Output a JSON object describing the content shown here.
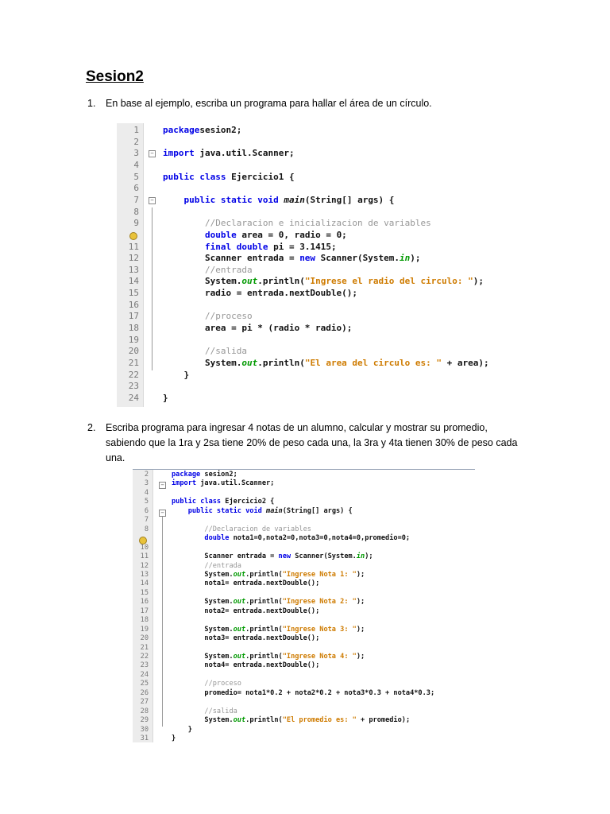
{
  "title": "Sesion2",
  "questions": [
    {
      "number": "1.",
      "text": "En base al ejemplo, escriba un programa para hallar el área de un círculo."
    },
    {
      "number": "2.",
      "text": "Escriba programa para ingresar 4 notas de un alumno, calcular y mostrar su promedio, sabiendo que la 1ra y 2sa tiene 20% de peso cada una, la 3ra y 4ta tienen 30% de peso cada una."
    }
  ],
  "code_blocks": [
    {
      "lines": [
        {
          "n": "1",
          "c": [
            [
              "kw",
              "package"
            ],
            [
              "",
              "sesion2;"
            ]
          ]
        },
        {
          "n": "2",
          "c": []
        },
        {
          "n": "3",
          "c": [
            [
              "kw",
              "import"
            ],
            [
              "",
              " java.util.Scanner;"
            ]
          ]
        },
        {
          "n": "4",
          "c": []
        },
        {
          "n": "5",
          "c": [
            [
              "kw",
              "public class"
            ],
            [
              "",
              " Ejercicio1 {"
            ]
          ]
        },
        {
          "n": "6",
          "c": []
        },
        {
          "n": "7",
          "c": [
            [
              "",
              "    "
            ],
            [
              "kw",
              "public static void"
            ],
            [
              "",
              " "
            ],
            [
              "it",
              "main"
            ],
            [
              "",
              "(String[] args) {"
            ]
          ]
        },
        {
          "n": "8",
          "c": []
        },
        {
          "n": "9",
          "c": [
            [
              "",
              "        "
            ],
            [
              "cm",
              "//Declaracion e inicializacion de variables"
            ]
          ]
        },
        {
          "n": "",
          "c": [
            [
              "",
              "        "
            ],
            [
              "kw",
              "double"
            ],
            [
              "",
              " area = 0, radio = 0;"
            ]
          ]
        },
        {
          "n": "11",
          "c": [
            [
              "",
              "        "
            ],
            [
              "kw",
              "final double"
            ],
            [
              "",
              " pi = 3.1415;"
            ]
          ]
        },
        {
          "n": "12",
          "c": [
            [
              "",
              "        Scanner entrada = "
            ],
            [
              "kw",
              "new"
            ],
            [
              "",
              " Scanner(System."
            ],
            [
              "st",
              "in"
            ],
            [
              "",
              ");"
            ]
          ]
        },
        {
          "n": "13",
          "c": [
            [
              "",
              "        "
            ],
            [
              "cm",
              "//entrada"
            ]
          ]
        },
        {
          "n": "14",
          "c": [
            [
              "",
              "        System."
            ],
            [
              "st",
              "out"
            ],
            [
              "",
              ".println("
            ],
            [
              "str",
              "\"Ingrese el radio del circulo: \""
            ],
            [
              "",
              ");"
            ]
          ]
        },
        {
          "n": "15",
          "c": [
            [
              "",
              "        radio = entrada.nextDouble();"
            ]
          ]
        },
        {
          "n": "16",
          "c": []
        },
        {
          "n": "17",
          "c": [
            [
              "",
              "        "
            ],
            [
              "cm",
              "//proceso"
            ]
          ]
        },
        {
          "n": "18",
          "c": [
            [
              "",
              "        area = pi * (radio * radio);"
            ]
          ]
        },
        {
          "n": "19",
          "c": []
        },
        {
          "n": "20",
          "c": [
            [
              "",
              "        "
            ],
            [
              "cm",
              "//salida"
            ]
          ]
        },
        {
          "n": "21",
          "c": [
            [
              "",
              "        System."
            ],
            [
              "st",
              "out"
            ],
            [
              "",
              ".println("
            ],
            [
              "str",
              "\"El area del circulo es: \""
            ],
            [
              "",
              " + area);"
            ]
          ]
        },
        {
          "n": "22",
          "c": [
            [
              "",
              "    }"
            ]
          ]
        },
        {
          "n": "23",
          "c": []
        },
        {
          "n": "24",
          "c": [
            [
              "",
              "}"
            ]
          ]
        }
      ]
    },
    {
      "lines": [
        {
          "n": "2",
          "c": [
            [
              "kw",
              "package"
            ],
            [
              "",
              " sesion2;"
            ]
          ]
        },
        {
          "n": "3",
          "c": [
            [
              "kw",
              "import"
            ],
            [
              "",
              " java.util.Scanner;"
            ]
          ]
        },
        {
          "n": "4",
          "c": []
        },
        {
          "n": "5",
          "c": [
            [
              "kw",
              "public class"
            ],
            [
              "",
              " Ejercicio2 {"
            ]
          ]
        },
        {
          "n": "6",
          "c": [
            [
              "",
              "    "
            ],
            [
              "kw",
              "public static void"
            ],
            [
              "",
              " "
            ],
            [
              "it",
              "main"
            ],
            [
              "",
              "(String[] args) {"
            ]
          ]
        },
        {
          "n": "7",
          "c": []
        },
        {
          "n": "8",
          "c": [
            [
              "",
              "        "
            ],
            [
              "cm",
              "//Declaracion de variables"
            ]
          ]
        },
        {
          "n": "",
          "c": [
            [
              "",
              "        "
            ],
            [
              "kw",
              "double"
            ],
            [
              "",
              " nota1=0,nota2=0,nota3=0,nota4=0,promedio=0;"
            ]
          ]
        },
        {
          "n": "10",
          "c": []
        },
        {
          "n": "11",
          "c": [
            [
              "",
              "        Scanner entrada = "
            ],
            [
              "kw",
              "new"
            ],
            [
              "",
              " Scanner(System."
            ],
            [
              "st",
              "in"
            ],
            [
              "",
              ");"
            ]
          ]
        },
        {
          "n": "12",
          "c": [
            [
              "",
              "        "
            ],
            [
              "cm",
              "//entrada"
            ]
          ]
        },
        {
          "n": "13",
          "c": [
            [
              "",
              "        System."
            ],
            [
              "st",
              "out"
            ],
            [
              "",
              ".println("
            ],
            [
              "str",
              "\"Ingrese Nota 1: \""
            ],
            [
              "",
              ");"
            ]
          ]
        },
        {
          "n": "14",
          "c": [
            [
              "",
              "        nota1= entrada.nextDouble();"
            ]
          ]
        },
        {
          "n": "15",
          "c": []
        },
        {
          "n": "16",
          "c": [
            [
              "",
              "        System."
            ],
            [
              "st",
              "out"
            ],
            [
              "",
              ".println("
            ],
            [
              "str",
              "\"Ingrese Nota 2: \""
            ],
            [
              "",
              ");"
            ]
          ]
        },
        {
          "n": "17",
          "c": [
            [
              "",
              "        nota2= entrada.nextDouble();"
            ]
          ]
        },
        {
          "n": "18",
          "c": []
        },
        {
          "n": "19",
          "c": [
            [
              "",
              "        System."
            ],
            [
              "st",
              "out"
            ],
            [
              "",
              ".println("
            ],
            [
              "str",
              "\"Ingrese Nota 3: \""
            ],
            [
              "",
              ");"
            ]
          ]
        },
        {
          "n": "20",
          "c": [
            [
              "",
              "        nota3= entrada.nextDouble();"
            ]
          ]
        },
        {
          "n": "21",
          "c": []
        },
        {
          "n": "22",
          "c": [
            [
              "",
              "        System."
            ],
            [
              "st",
              "out"
            ],
            [
              "",
              ".println("
            ],
            [
              "str",
              "\"Ingrese Nota 4: \""
            ],
            [
              "",
              ");"
            ]
          ]
        },
        {
          "n": "23",
          "c": [
            [
              "",
              "        nota4= entrada.nextDouble();"
            ]
          ]
        },
        {
          "n": "24",
          "c": []
        },
        {
          "n": "25",
          "c": [
            [
              "",
              "        "
            ],
            [
              "cm",
              "//proceso"
            ]
          ]
        },
        {
          "n": "26",
          "c": [
            [
              "",
              "        promedio= nota1*0.2 + nota2*0.2 + nota3*0.3 + nota4*0.3;"
            ]
          ]
        },
        {
          "n": "27",
          "c": []
        },
        {
          "n": "28",
          "c": [
            [
              "",
              "        "
            ],
            [
              "cm",
              "//salida"
            ]
          ]
        },
        {
          "n": "29",
          "c": [
            [
              "",
              "        System."
            ],
            [
              "st",
              "out"
            ],
            [
              "",
              ".println("
            ],
            [
              "str",
              "\"El promedio es: \""
            ],
            [
              "",
              " + promedio);"
            ]
          ]
        },
        {
          "n": "30",
          "c": [
            [
              "",
              "    }"
            ]
          ]
        },
        {
          "n": "31",
          "c": [
            [
              "",
              "}"
            ]
          ]
        }
      ]
    }
  ]
}
